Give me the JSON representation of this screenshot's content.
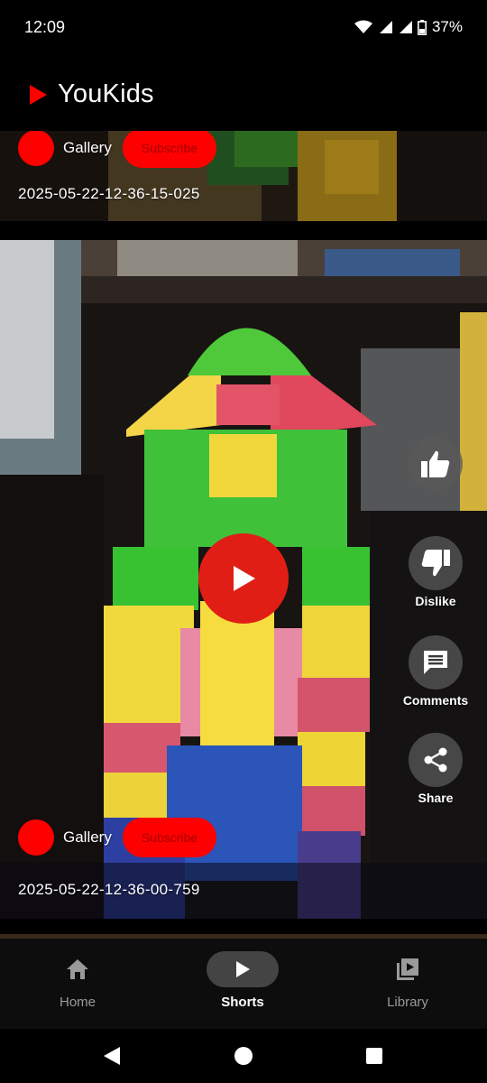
{
  "status_bar": {
    "time": "12:09",
    "battery": "37%"
  },
  "app": {
    "title": "YouKids",
    "accent": "#ff0000"
  },
  "feed": [
    {
      "channel": "Gallery",
      "subscribe_label": "Subscribe",
      "title": "2025-05-22-12-36-15-025"
    },
    {
      "channel": "Gallery",
      "subscribe_label": "Subscribe",
      "title": "2025-05-22-12-36-00-759"
    }
  ],
  "actions": {
    "dislike": "Dislike",
    "comments": "Comments",
    "share": "Share"
  },
  "bottom_nav": [
    {
      "label": "Home",
      "icon": "home-icon",
      "active": false
    },
    {
      "label": "Shorts",
      "icon": "play-icon",
      "active": true
    },
    {
      "label": "Library",
      "icon": "library-icon",
      "active": false
    }
  ]
}
